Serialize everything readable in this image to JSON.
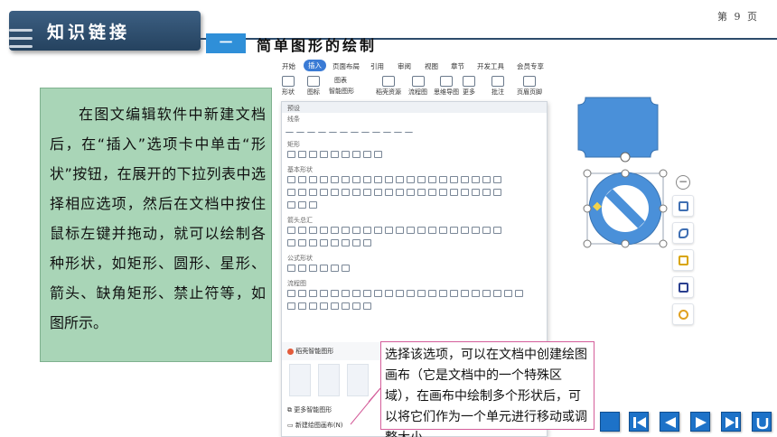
{
  "header": {
    "banner_title": "知识链接",
    "page_number": "第 9 页",
    "section_badge": "一",
    "section_title": "简单图形的绘制"
  },
  "description": "在图文编辑软件中新建文档后，在“插入”选项卡中单击“形状”按钮，在展开的下拉列表中选择相应选项，然后在文档中按住鼠标左键并拖动，就可以绘制各种形状，如矩形、圆形、星形、箭头、缺角矩形、禁止符等，如图所示。",
  "ribbon": {
    "tabs": [
      "开始",
      "插入",
      "页面布局",
      "引用",
      "审阅",
      "视图",
      "章节",
      "开发工具",
      "会员专享"
    ],
    "active_tab": "插入",
    "tools": [
      "形状",
      "图标",
      "智能图形",
      "稻壳资源",
      "流程图",
      "思维导图",
      "更多",
      "批注",
      "页眉页脚"
    ],
    "table_label": "图表"
  },
  "dropdown": {
    "header": "预设",
    "categories": [
      "线条",
      "矩形",
      "基本形状",
      "箭头总汇",
      "公式形状",
      "流程图"
    ],
    "smart_shapes": "稻壳智能图形",
    "more_smart": "更多智能图形",
    "new_canvas": "新建绘图画布(N)"
  },
  "callout": "选择该选项，可以在文档中创建绘图画布（它是文档中的一个特殊区域），在画布中绘制多个形状后，可以将它们作为一个单元进行移动或调整大小",
  "colors": {
    "banner": "#2d4b6b",
    "accent": "#2f8fd8",
    "panel": "#a9d5b7",
    "shape_fill": "#4a90d9",
    "callout_border": "#d45d9a"
  }
}
